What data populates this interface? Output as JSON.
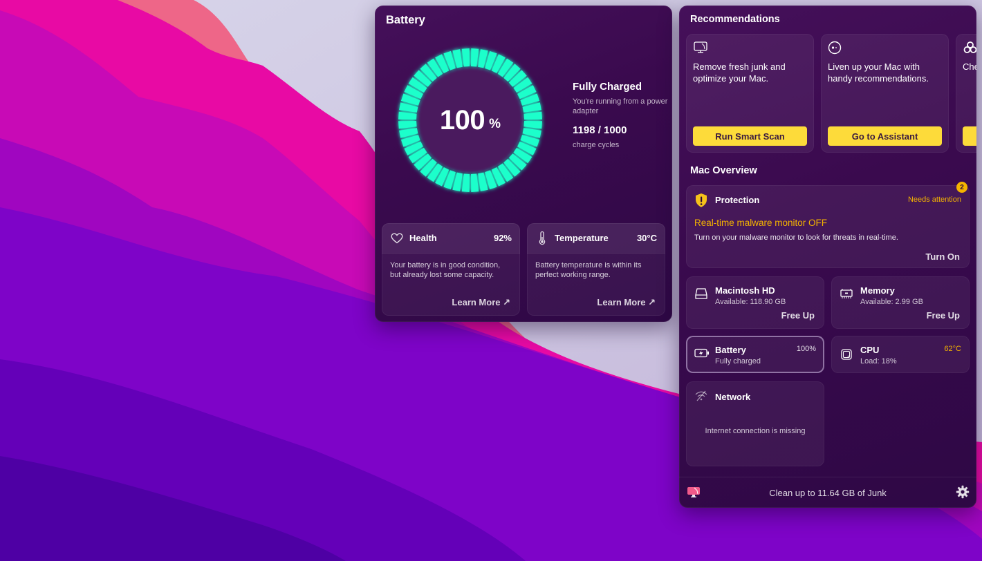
{
  "battery_panel": {
    "title": "Battery",
    "gauge": {
      "percent": 100,
      "value_text": "100",
      "unit": "%",
      "segments": 48,
      "color": "#1dffcb"
    },
    "status_title": "Fully Charged",
    "status_sub": "You're running from a power adapter",
    "cycles_text": "1198 / 1000",
    "cycles_label": "charge cycles",
    "health": {
      "icon": "heart-icon",
      "label": "Health",
      "value": "92%",
      "description": "Your battery is in good condition, but already lost some capacity.",
      "link": "Learn More ↗"
    },
    "temperature": {
      "icon": "thermometer-icon",
      "label": "Temperature",
      "value": "30°C",
      "description": "Battery temperature is within its perfect working range.",
      "link": "Learn More ↗"
    }
  },
  "main_panel": {
    "recommendations_title": "Recommendations",
    "recommendations": [
      {
        "icon": "imac-cleanup-icon",
        "text": "Remove fresh junk and optimize your Mac.",
        "button": "Run Smart Scan"
      },
      {
        "icon": "assistant-icon",
        "text": "Liven up your Mac with handy recommendations.",
        "button": "Go to Assistant"
      },
      {
        "icon": "biohazard-icon",
        "text": "Check for vulnerabilities",
        "button": ""
      }
    ],
    "overview_title": "Mac Overview",
    "protection": {
      "icon": "shield-warning-icon",
      "label": "Protection",
      "status": "Needs attention",
      "badge": "2",
      "alert": "Real-time malware monitor OFF",
      "description": "Turn on your malware monitor to look for threats in real-time.",
      "action": "Turn On"
    },
    "disk": {
      "icon": "hard-drive-icon",
      "label": "Macintosh HD",
      "sub": "Available: 118.90 GB",
      "action": "Free Up"
    },
    "memory": {
      "icon": "memory-chip-icon",
      "label": "Memory",
      "sub": "Available: 2.99 GB",
      "action": "Free Up"
    },
    "battery": {
      "icon": "battery-charging-icon",
      "label": "Battery",
      "sub": "Fully charged",
      "value": "100%"
    },
    "cpu": {
      "icon": "cpu-icon",
      "label": "CPU",
      "sub": "Load: 18%",
      "value": "62°C"
    },
    "network": {
      "icon": "wifi-off-icon",
      "label": "Network",
      "message": "Internet connection is missing"
    },
    "footer": {
      "text": "Clean up to 11.64 GB of Junk",
      "logo": "cleanmymac-logo-icon",
      "settings": "gear-icon"
    }
  },
  "colors": {
    "accent_yellow": "#fddb3a",
    "warning_orange": "#f5b400",
    "gauge_green": "#1dffcb",
    "panel_bg": "#3a0a4e"
  }
}
